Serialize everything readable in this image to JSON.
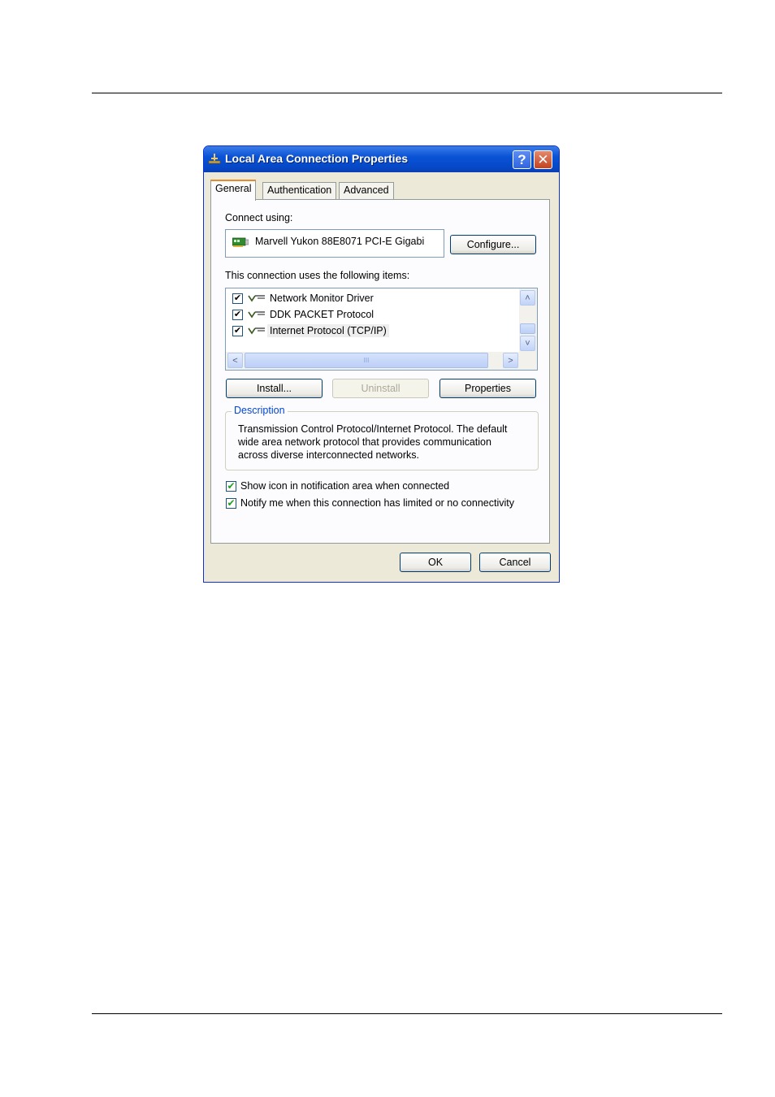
{
  "dialog": {
    "title": "Local Area Connection Properties",
    "help_symbol": "?",
    "close_symbol": "✕"
  },
  "tabs": [
    {
      "label": "General",
      "active": true
    },
    {
      "label": "Authentication",
      "active": false
    },
    {
      "label": "Advanced",
      "active": false
    }
  ],
  "general": {
    "connect_using_label": "Connect using:",
    "adapter_name": "Marvell Yukon 88E8071 PCI-E Gigabi",
    "configure_button": "Configure...",
    "items_label": "This connection uses the following items:",
    "items": [
      {
        "label": "Network Monitor Driver",
        "checked": true,
        "check_symbol": "✔"
      },
      {
        "label": "DDK PACKET Protocol",
        "checked": true,
        "check_symbol": "✔"
      },
      {
        "label": "Internet Protocol (TCP/IP)",
        "checked": true,
        "check_symbol": "✔",
        "selected": true
      }
    ],
    "scroll": {
      "up": "˄",
      "down": "˅",
      "left": "<",
      "right": ">",
      "thumb_grip": "III"
    },
    "install_button": "Install...",
    "uninstall_button": "Uninstall",
    "properties_button": "Properties",
    "description_title": "Description",
    "description_text": "Transmission Control Protocol/Internet Protocol. The default wide area network protocol that provides communication across diverse interconnected networks.",
    "show_icon_label": "Show icon in notification area when connected",
    "show_icon_checked": true,
    "notify_label": "Notify me when this connection has limited or no connectivity",
    "notify_checked": true,
    "check_symbol": "✔"
  },
  "footer": {
    "ok_button": "OK",
    "cancel_button": "Cancel"
  },
  "icons": {
    "title": "network-connection-icon",
    "adapter": "network-card-icon",
    "protocol": "protocol-icon"
  },
  "colors": {
    "titlebar": "#0A53D6",
    "dialog_bg": "#ECE9D8",
    "active_tab_accent": "#E68B2C",
    "check_green": "#21A121",
    "group_title": "#0046D5"
  }
}
